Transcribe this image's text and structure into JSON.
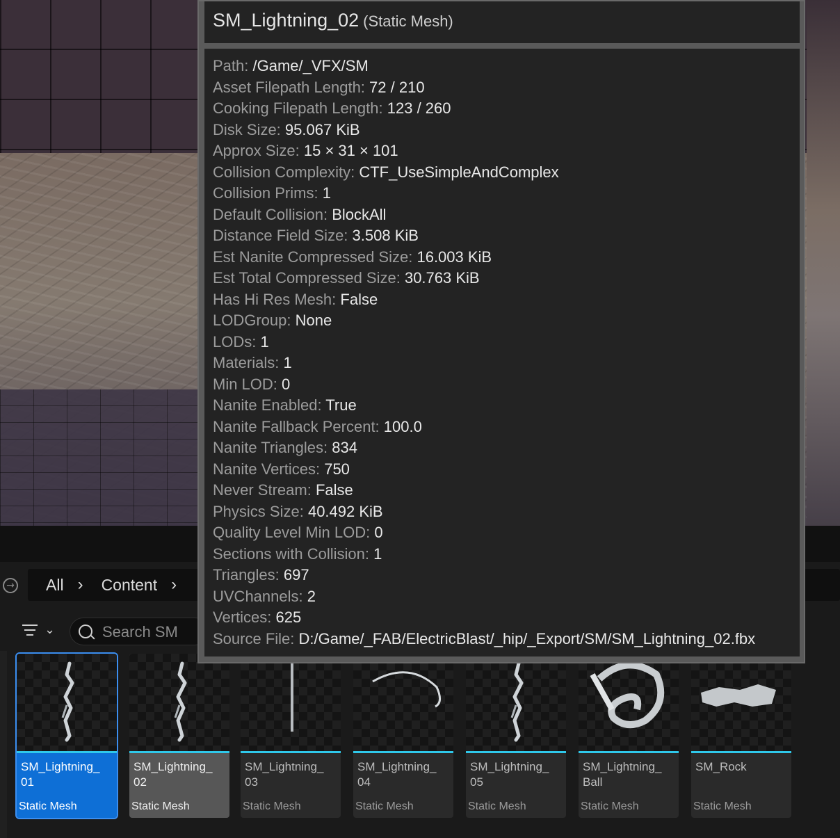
{
  "tooltip": {
    "title": "SM_Lightning_02",
    "kind": "(Static Mesh)",
    "properties": [
      {
        "key": "Path:",
        "value": "/Game/_VFX/SM"
      },
      {
        "key": "Asset Filepath Length:",
        "value": "72 / 210"
      },
      {
        "key": "Cooking Filepath Length:",
        "value": "123 / 260"
      },
      {
        "key": "Disk Size:",
        "value": "95.067 KiB"
      },
      {
        "key": "Approx Size:",
        "value": "15 × 31 × 101"
      },
      {
        "key": "Collision Complexity:",
        "value": "CTF_UseSimpleAndComplex"
      },
      {
        "key": "Collision Prims:",
        "value": "1"
      },
      {
        "key": "Default Collision:",
        "value": "BlockAll"
      },
      {
        "key": "Distance Field Size:",
        "value": "3.508 KiB"
      },
      {
        "key": "Est Nanite Compressed Size:",
        "value": "16.003 KiB"
      },
      {
        "key": "Est Total Compressed Size:",
        "value": "30.763 KiB"
      },
      {
        "key": "Has Hi Res Mesh:",
        "value": "False"
      },
      {
        "key": "LODGroup:",
        "value": "None"
      },
      {
        "key": "LODs:",
        "value": "1"
      },
      {
        "key": "Materials:",
        "value": "1"
      },
      {
        "key": "Min LOD:",
        "value": "0"
      },
      {
        "key": "Nanite Enabled:",
        "value": "True"
      },
      {
        "key": "Nanite Fallback Percent:",
        "value": "100.0"
      },
      {
        "key": "Nanite Triangles:",
        "value": "834"
      },
      {
        "key": "Nanite Vertices:",
        "value": "750"
      },
      {
        "key": "Never Stream:",
        "value": "False"
      },
      {
        "key": "Physics Size:",
        "value": "40.492 KiB"
      },
      {
        "key": "Quality Level Min LOD:",
        "value": "0"
      },
      {
        "key": "Sections with Collision:",
        "value": "1"
      },
      {
        "key": "Triangles:",
        "value": "697"
      },
      {
        "key": "UVChannels:",
        "value": "2"
      },
      {
        "key": "Vertices:",
        "value": "625"
      },
      {
        "key": "Source File:",
        "value": "D:/Game/_FAB/ElectricBlast/_hip/_Export/SM/SM_Lightning_02.fbx"
      }
    ]
  },
  "breadcrumb": {
    "items": [
      "All",
      "Content"
    ]
  },
  "search": {
    "placeholder": "Search SM"
  },
  "assets": [
    {
      "name": "SM_Lightning_\n01",
      "type": "Static Mesh",
      "state": "selected",
      "thumb": "bolt-tall"
    },
    {
      "name": "SM_Lightning_\n02",
      "type": "Static Mesh",
      "state": "hover",
      "thumb": "bolt-tall"
    },
    {
      "name": "SM_Lightning_\n03",
      "type": "Static Mesh",
      "state": "normal",
      "thumb": "line"
    },
    {
      "name": "SM_Lightning_\n04",
      "type": "Static Mesh",
      "state": "normal",
      "thumb": "arc"
    },
    {
      "name": "SM_Lightning_\n05",
      "type": "Static Mesh",
      "state": "normal",
      "thumb": "bolt-tall"
    },
    {
      "name": "SM_Lightning_\nBall",
      "type": "Static Mesh",
      "state": "normal",
      "thumb": "ball"
    },
    {
      "name": "SM_Rock",
      "type": "Static Mesh",
      "state": "normal",
      "thumb": "rock"
    }
  ],
  "colors": {
    "accent": "#2fc8ea",
    "selection": "#0e6fd6"
  },
  "icons": {
    "back": "circle-arrow-right-icon",
    "chevron": "chevron-right-icon",
    "filter": "filter-icon",
    "search": "search-icon"
  }
}
